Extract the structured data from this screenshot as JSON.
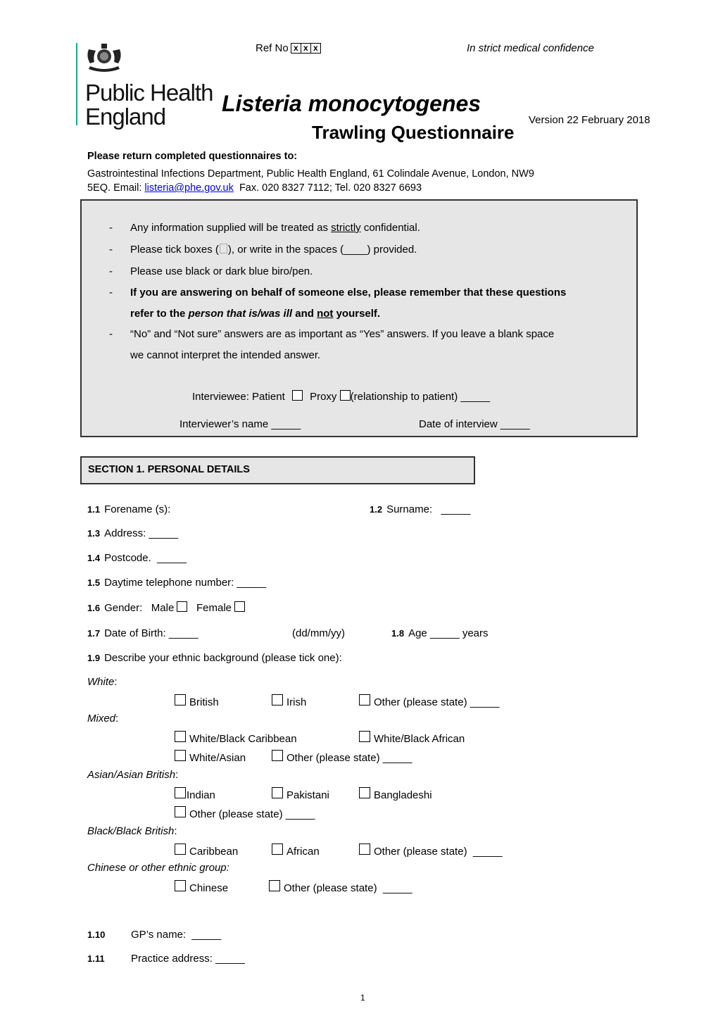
{
  "header": {
    "organisation": [
      "Public Health",
      "England"
    ],
    "ref_label": "Ref No",
    "ref_boxes": [
      "x",
      "x",
      "x"
    ],
    "confidentiality": "In strict medical confidence",
    "title": "Listeria monocytogenes",
    "subtitle": "Trawling Questionnaire",
    "version": "Version 22 February 2018"
  },
  "return_info": {
    "heading": "Please return completed questionnaires to:",
    "line1": "Gastrointestinal Infections Department, Public Health England, 61 Colindale Avenue, London, NW9",
    "line2_prefix": "5EQ. Email: ",
    "email": "listeria@phe.gov.uk",
    "line2_suffix": "  Fax. 020 8327 7112; Tel. 020 8327 6693"
  },
  "instructions": {
    "bullet": "-",
    "i1_a": "Any information supplied will be treated as ",
    "i1_u": "strictly",
    "i1_b": " confidential.",
    "i2_a": "Please tick boxes (",
    "i2_b": "), or write in the spaces (____) provided.",
    "i3": "Please use black or dark blue biro/pen.",
    "i4_line1": "If you are answering on behalf of someone else, please remember that these questions",
    "i4_a": "refer to the ",
    "i4_i": "person that is/was ill",
    "i4_b": " and ",
    "i4_u": "not",
    "i4_c": " yourself.",
    "i5_line1": " “No” and “Not sure” answers are as important as “Yes” answers. If you leave a blank space",
    "i5_line2": "we cannot interpret the intended answer.",
    "interviewee_label": "Interviewee:  Patient",
    "proxy_label": "Proxy",
    "relationship_label": "(relationship to patient) _____",
    "interviewer_label": "Interviewer’s name _____",
    "date_label": "Date of interview _____"
  },
  "section1": {
    "title": "SECTION 1. PERSONAL DETAILS",
    "q1_1": {
      "num": "1.1",
      "label": "Forename (s):"
    },
    "q1_2": {
      "num": "1.2",
      "label": "Surname:   _____"
    },
    "q1_3": {
      "num": "1.3",
      "label": "Address: _____"
    },
    "q1_4": {
      "num": "1.4",
      "label": "Postcode.  _____"
    },
    "q1_5": {
      "num": "1.5",
      "label": "Daytime telephone number: _____"
    },
    "q1_6": {
      "num": "1.6",
      "label": "Gender:   Male",
      "female": "Female"
    },
    "q1_7": {
      "num": "1.7",
      "label": "Date of Birth: _____",
      "format": "(dd/mm/yy)"
    },
    "q1_8": {
      "num": "1.8",
      "label": "Age _____ years"
    },
    "q1_9": {
      "num": "1.9",
      "label": "Describe your ethnic background (please tick one):"
    },
    "ethnic": {
      "white": {
        "label": "White",
        "options": [
          "British",
          "Irish",
          "Other (please state) _____"
        ]
      },
      "mixed": {
        "label": "Mixed",
        "options": [
          "White/Black Caribbean",
          "White/Black African",
          "White/Asian",
          "Other (please state) _____"
        ]
      },
      "asian": {
        "label": "Asian/Asian British",
        "options": [
          "Indian",
          "Pakistani",
          "Bangladeshi",
          "Other (please state) _____"
        ]
      },
      "black": {
        "label": "Black/Black British",
        "options": [
          "Caribbean",
          "African",
          "Other (please state)  _____"
        ]
      },
      "chinese": {
        "label": "Chinese or  other ethnic group:",
        "options": [
          "Chinese",
          "Other (please state)  _____"
        ]
      }
    },
    "q1_10": {
      "num": "1.10",
      "label": "GP’s name:  _____"
    },
    "q1_11": {
      "num": "1.11",
      "label": "Practice address: _____"
    }
  },
  "footer": {
    "page_number": "1"
  }
}
